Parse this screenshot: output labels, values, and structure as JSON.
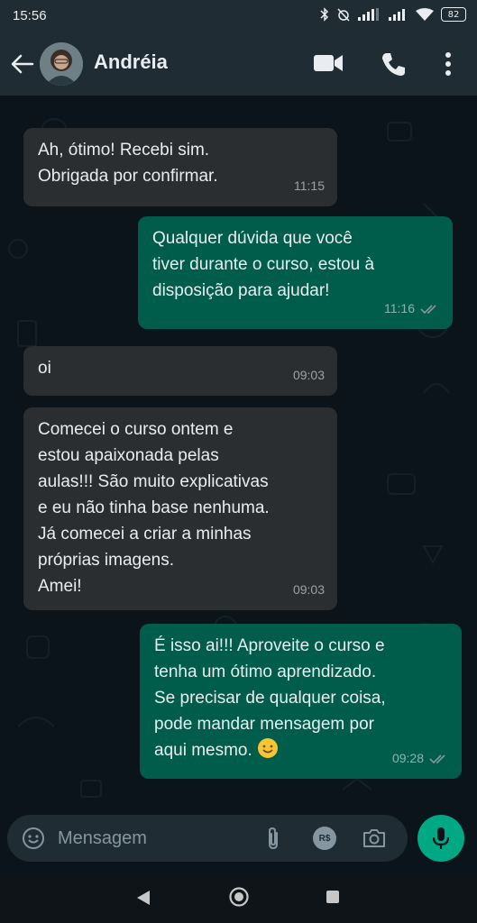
{
  "status_bar": {
    "time": "15:56",
    "battery": "82"
  },
  "header": {
    "contact_name": "Andréia"
  },
  "messages": [
    {
      "direction": "in",
      "text": "Ah, ótimo! Recebi sim.\nObrigada por confirmar.",
      "time": "11:15"
    },
    {
      "direction": "out",
      "text": "Qualquer dúvida que você\ntiver durante o curso, estou à\ndisposição para ajudar!",
      "time": "11:16",
      "status": "read"
    },
    {
      "direction": "in",
      "text": "oi",
      "time": "09:03"
    },
    {
      "direction": "in",
      "text": "Comecei o curso ontem e\nestou apaixonada pelas\naulas!!! São muito explicativas\ne eu não tinha base nenhuma.\nJá comecei a criar a minhas\npróprias imagens.\nAmei!",
      "time": "09:03"
    },
    {
      "direction": "out",
      "text": "É isso ai!!! Aproveite o curso e\ntenha um ótimo aprendizado.\nSe precisar de qualquer coisa,\npode mandar mensagem por\naqui mesmo. ",
      "emoji": "smiling-face",
      "time": "09:28",
      "status": "read"
    }
  ],
  "composer": {
    "placeholder": "Mensagem",
    "payment_label": "R$"
  },
  "colors": {
    "incoming_bubble": "#2a2e31",
    "outgoing_bubble": "#005c4b",
    "header": "#1f2c34",
    "accent": "#00a884",
    "read_ticks": "#8696a0"
  },
  "icons": [
    "back-arrow-icon",
    "video-call-icon",
    "phone-icon",
    "more-options-icon",
    "emoji-icon",
    "attach-icon",
    "payment-icon",
    "camera-icon",
    "microphone-icon",
    "nav-back-icon",
    "nav-home-icon",
    "nav-recents-icon"
  ]
}
